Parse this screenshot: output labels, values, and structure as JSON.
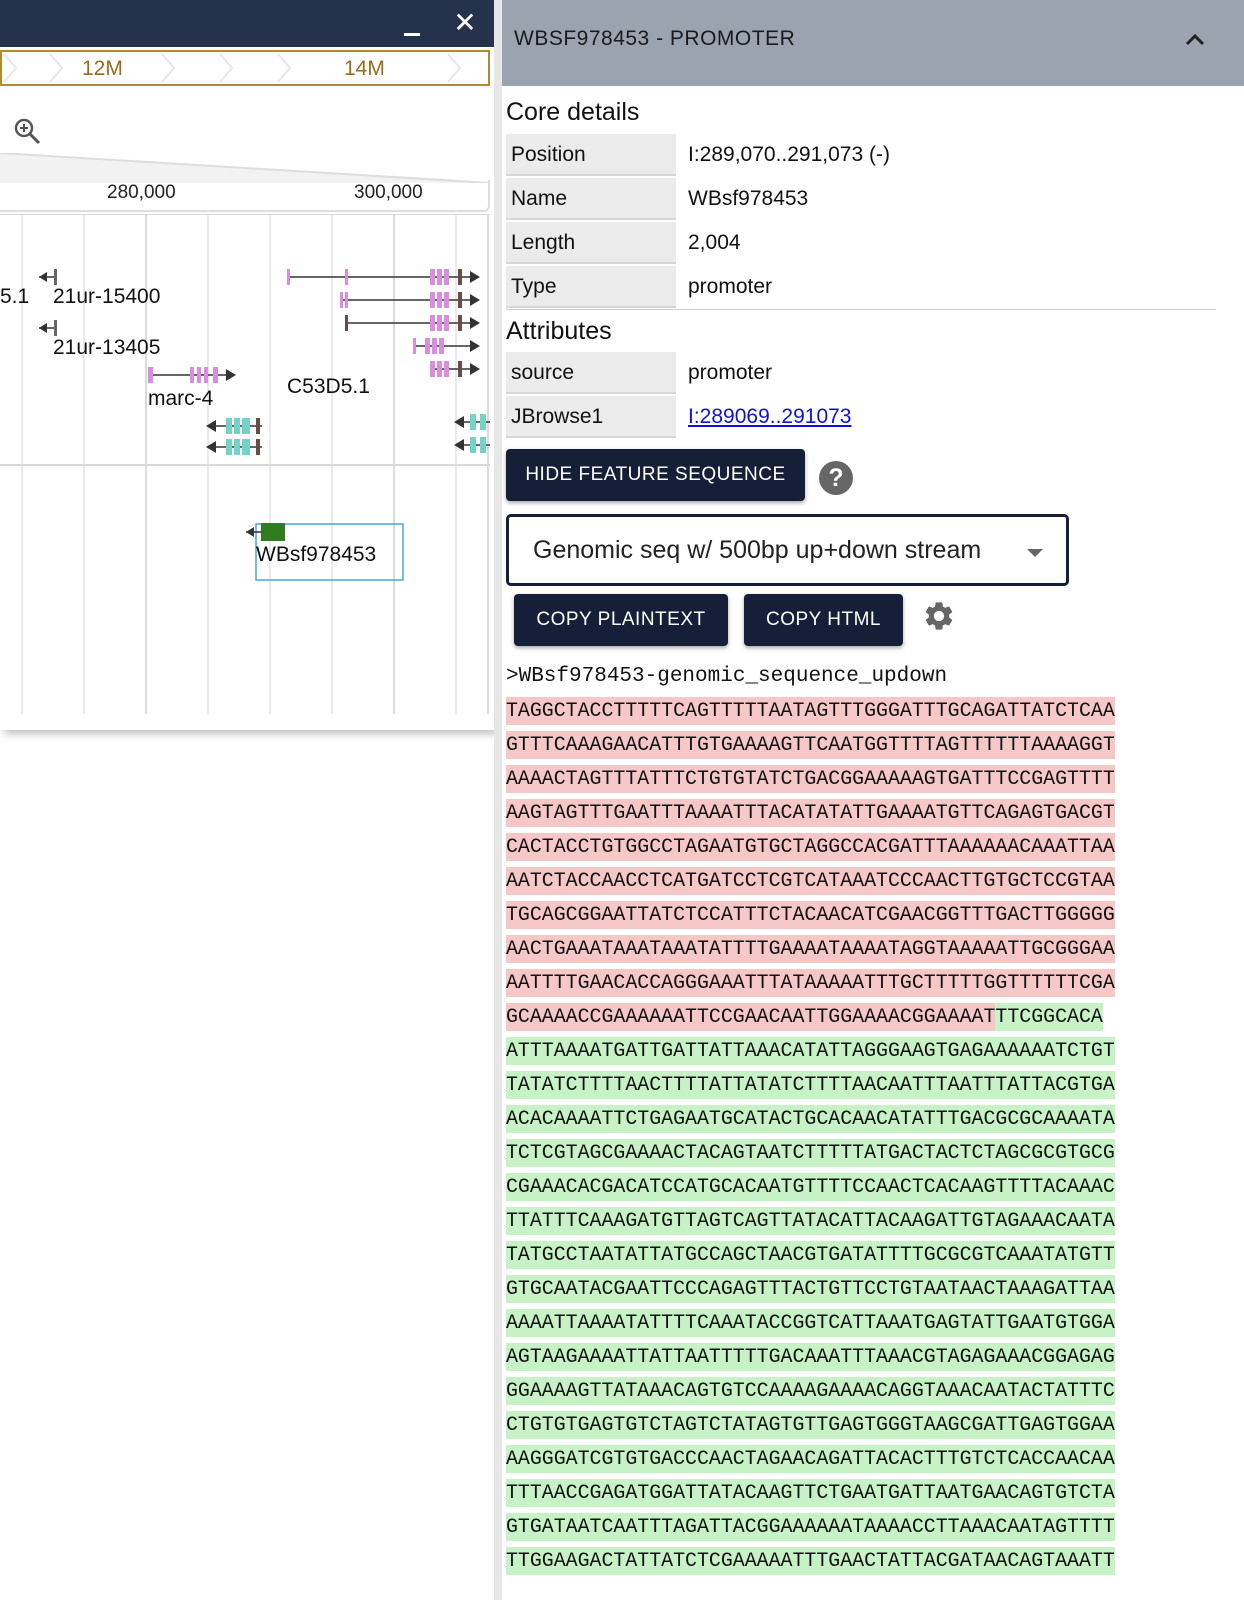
{
  "browser": {
    "window_controls": {
      "minimize_icon": "minimize-icon",
      "close_icon": "close-icon",
      "close_glyph": "✕"
    },
    "overview_labels": [
      "12M",
      "14M"
    ],
    "scale_labels": [
      "280,000",
      "300,000"
    ],
    "feature_labels": {
      "partial": "5.1",
      "gene1": "21ur-15400",
      "gene2": "21ur-13405",
      "gene3": "marc-4",
      "gene4": "C53D5.1",
      "selected": "WBsf978453"
    }
  },
  "widget": {
    "title": "WBSF978453 - PROMOTER",
    "core_title": "Core details",
    "core": [
      {
        "key": "Position",
        "value": "I:289,070..291,073 (-)"
      },
      {
        "key": "Name",
        "value": "WBsf978453"
      },
      {
        "key": "Length",
        "value": "2,004"
      },
      {
        "key": "Type",
        "value": "promoter"
      }
    ],
    "attributes_title": "Attributes",
    "attributes": [
      {
        "key": "source",
        "value": "promoter"
      },
      {
        "key": "JBrowse1",
        "value": "I:289069..291073"
      }
    ],
    "hide_seq_label": "HIDE FEATURE SEQUENCE",
    "help_glyph": "?",
    "seq_mode": "Genomic seq w/ 500bp up+down stream",
    "copy_plain_label": "COPY PLAINTEXT",
    "copy_html_label": "COPY HTML",
    "sequence": {
      "header": ">WBsf978453-genomic_sequence_updown",
      "lines": [
        {
          "up": "TAGGCTACCTTTTTCAGTTTTTAATAGTTTGGGATTTGCAGATTATCTCAA",
          "core": ""
        },
        {
          "up": "GTTTCAAAGAACATTTGTGAAAAGTTCAATGGTTTTAGTTTTTTAAAAGGT",
          "core": ""
        },
        {
          "up": "AAAACTAGTTTATTTCTGTGTATCTGACGGAAAAAGTGATTTCCGAGTTTT",
          "core": ""
        },
        {
          "up": "AAGTAGTTTGAATTTAAAATTTACATATATTGAAAATGTTCAGAGTGACGT",
          "core": ""
        },
        {
          "up": "CACTACCTGTGGCCTAGAATGTGCTAGGCCACGATTTAAAAAACAAATTAA",
          "core": ""
        },
        {
          "up": "AATCTACCAACCTCATGATCCTCGTCATAAATCCCAACTTGTGCTCCGTAA",
          "core": ""
        },
        {
          "up": "TGCAGCGGAATTATCTCCATTTCTACAACATCGAACGGTTTGACTTGGGGG",
          "core": ""
        },
        {
          "up": "AACTGAAATAAATAAATATTTTGAAAATAAAATAGGTAAAAATTGCGGGAA",
          "core": ""
        },
        {
          "up": "AATTTTGAACACCAGGGAAATTTATAAAAATTTGCTTTTTGGTTTTTTCGA",
          "core": ""
        },
        {
          "up": "GCAAAACCGAAAAAATTCCGAACAATTGGAAAACGGAAAAT",
          "core": "TTCGGCACA"
        },
        {
          "up": "",
          "core": "ATTTAAAATGATTGATTATTAAACATATTAGGGAAGTGAGAAAAAATCTGT"
        },
        {
          "up": "",
          "core": "TATATCTTTTAACTTTTATTATATCTTTTAACAATTTAATTTATTACGTGA"
        },
        {
          "up": "",
          "core": "ACACAAAATTCTGAGAATGCATACTGCACAACATATTTGACGCGCAAAATA"
        },
        {
          "up": "",
          "core": "TCTCGTAGCGAAAACTACAGTAATCTTTTTATGACTACTCTAGCGCGTGCG"
        },
        {
          "up": "",
          "core": "CGAAACACGACATCCATGCACAATGTTTTCCAACTCACAAGTTTTACAAAC"
        },
        {
          "up": "",
          "core": "TTATTTCAAAGATGTTAGTCAGTTATACATTACAAGATTGTAGAAACAATA"
        },
        {
          "up": "",
          "core": "TATGCCTAATATTATGCCAGCTAACGTGATATTTTGCGCGTCAAATATGTT"
        },
        {
          "up": "",
          "core": "GTGCAATACGAATTCCCAGAGTTTACTGTTCCTGTAATAACTAAAGATTAA"
        },
        {
          "up": "",
          "core": "AAAATTAAAATATTTTCAAATACCGGTCATTAAATGAGTATTGAATGTGGA"
        },
        {
          "up": "",
          "core": "AGTAAGAAAATTATTAATTTTTGACAAATTTAAACGTAGAGAAACGGAGAG"
        },
        {
          "up": "",
          "core": "GGAAAAGTTATAAACAGTGTCCAAAAGAAAACAGGTAAACAATACTATTTC"
        },
        {
          "up": "",
          "core": "CTGTGTGAGTGTCTAGTCTATAGTGTTGAGTGGGTAAGCGATTGAGTGGAA"
        },
        {
          "up": "",
          "core": "AAGGGATCGTGTGACCCAACTAGAACAGATTACACTTTGTCTCACCAACAA"
        },
        {
          "up": "",
          "core": "TTTAACCGAGATGGATTATACAAGTTCTGAATGATTAATGAACAGTGTCTA"
        },
        {
          "up": "",
          "core": "GTGATAATCAATTTAGATTACGGAAAAAATAAAACCTTAAACAATAGTTTT"
        },
        {
          "up": "",
          "core": "TTGGAAGACTATTATCTCGAAAAATTTGAACTATTACGATAACAGTAAATT"
        }
      ]
    }
  },
  "colors": {
    "titlebar": "#24324c",
    "overview_border": "#b48a2f",
    "header_bg": "#9aa4b1",
    "button_dark": "#152038",
    "gene_pink": "#d98ce0",
    "gene_cyan": "#72d4c8",
    "feature_green": "#2f7d1e",
    "upstream_highlight": "#f5c7c7",
    "feature_highlight": "#c6f2c6",
    "link": "#1010d8"
  }
}
